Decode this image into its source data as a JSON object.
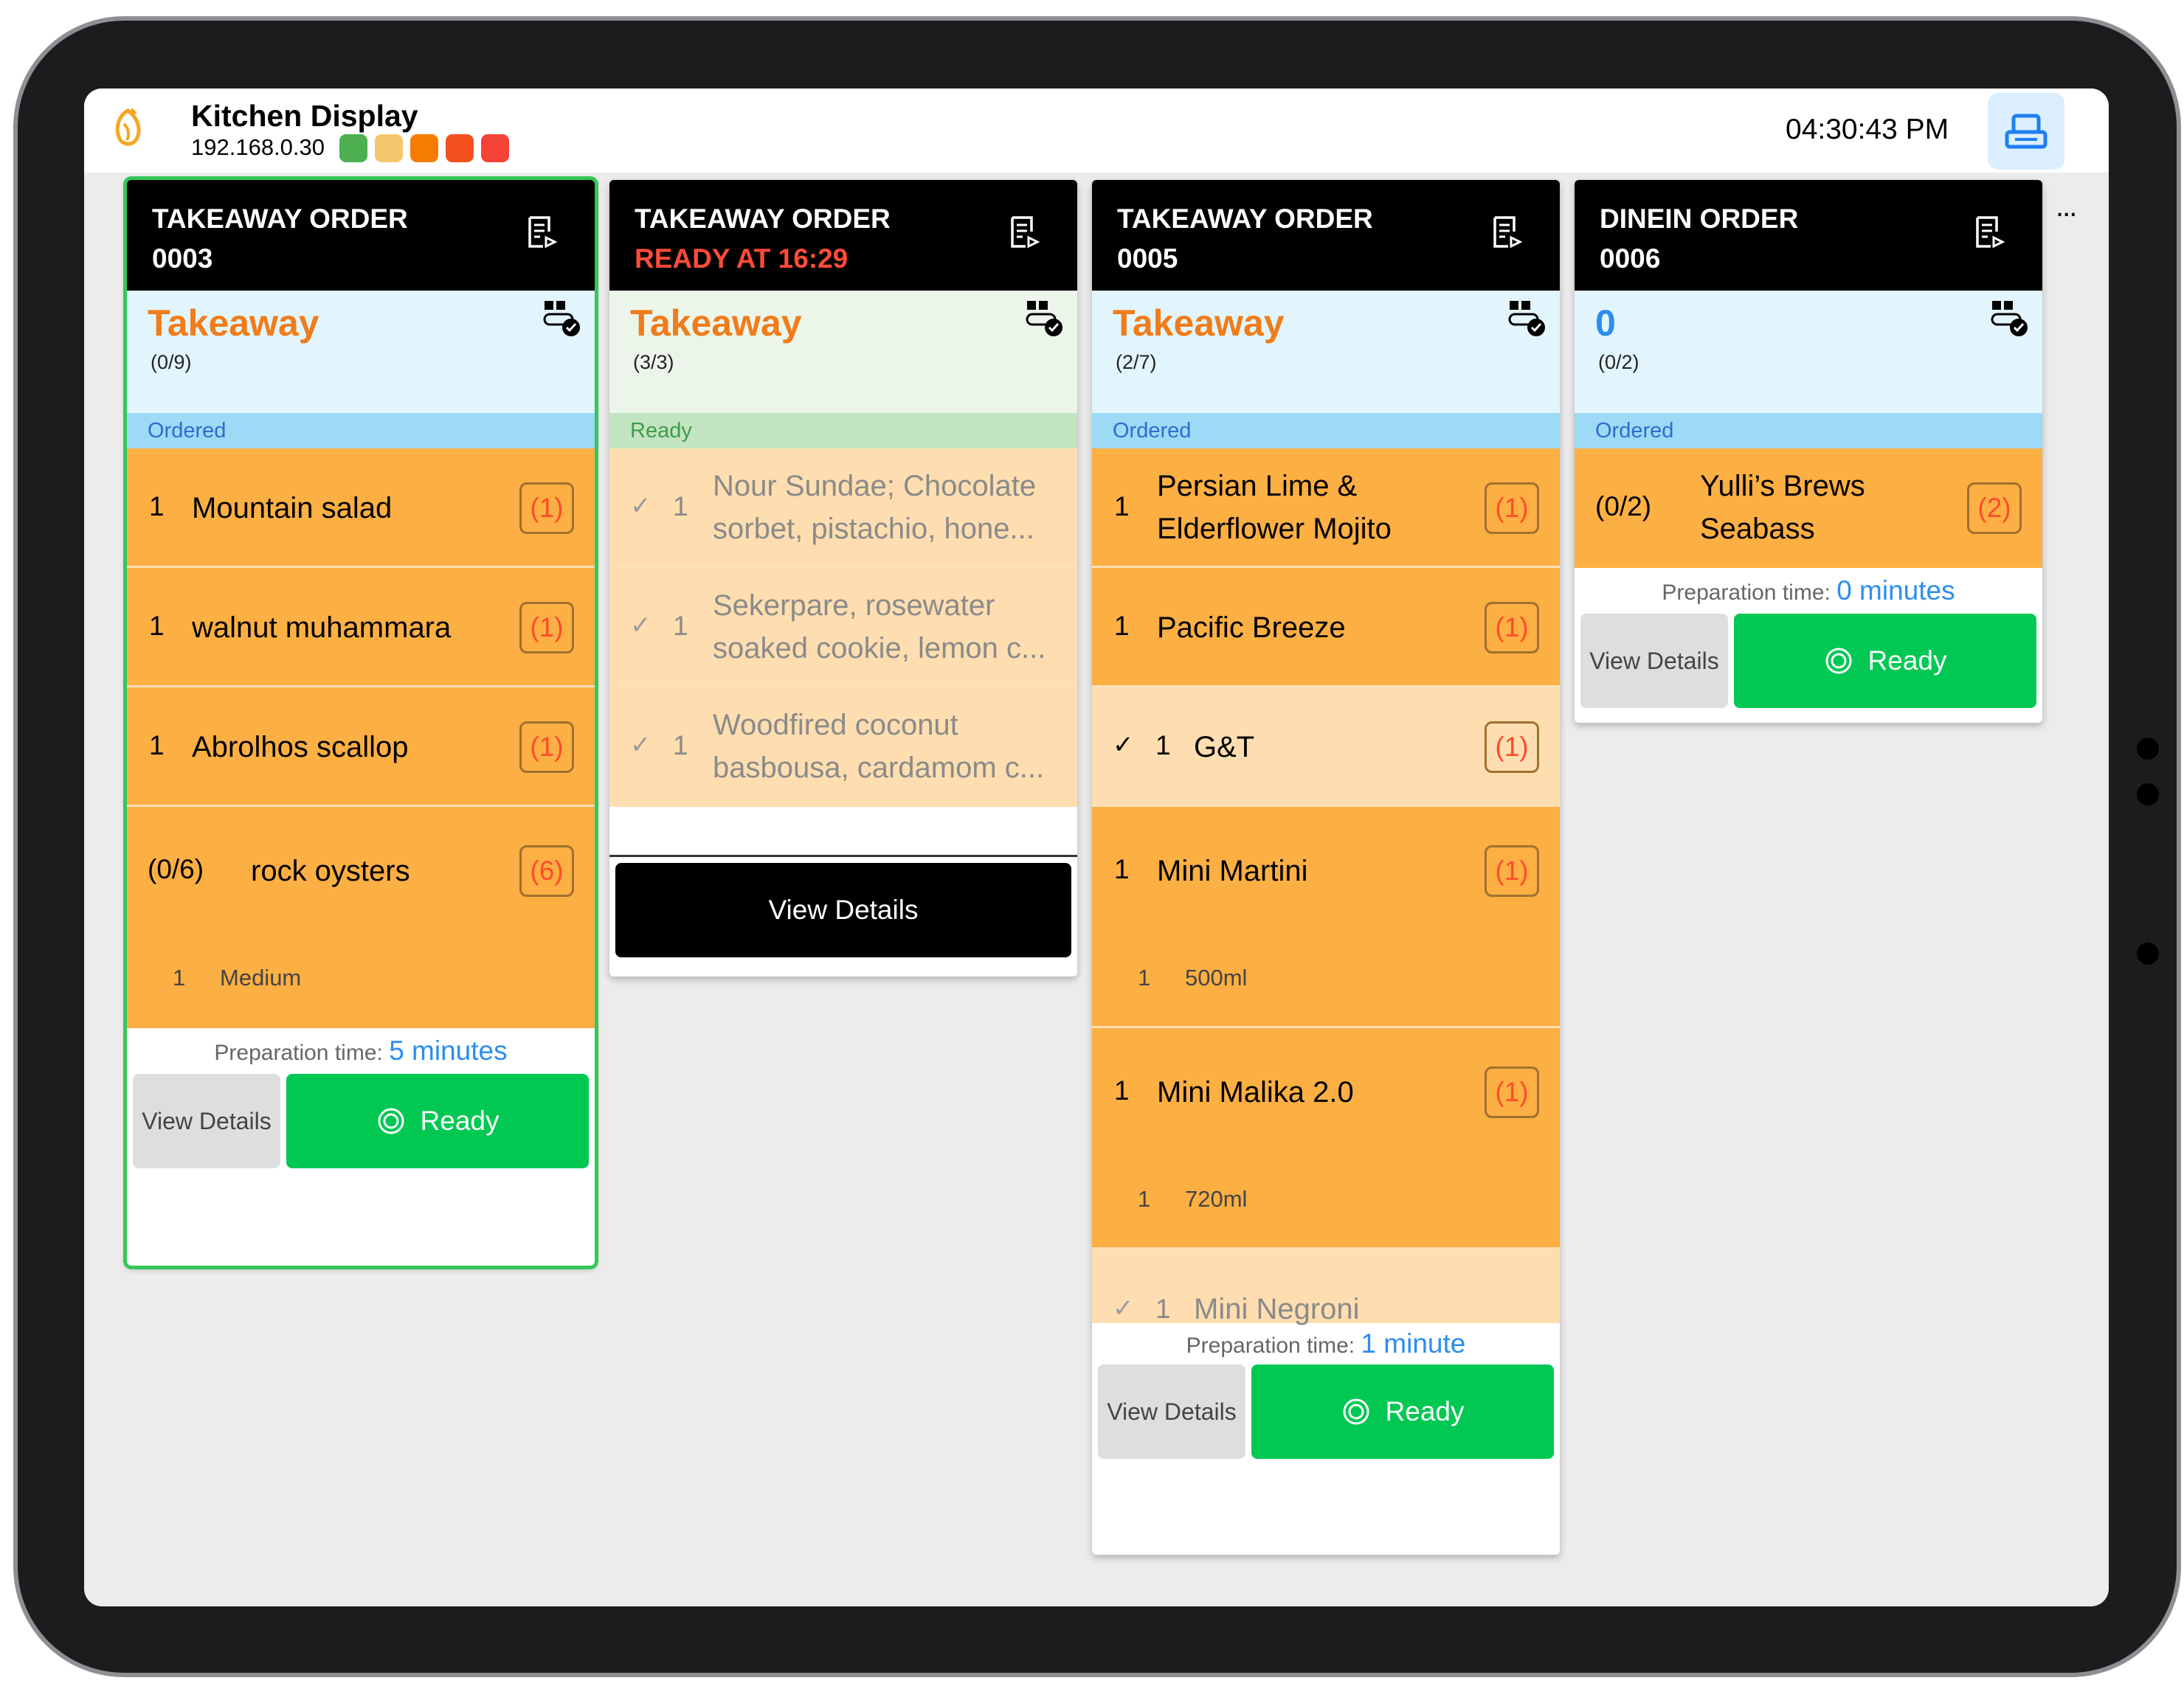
{
  "header": {
    "title": "Kitchen Display",
    "ip": "192.168.0.30",
    "status_colors": [
      "#4caf50",
      "#f6c66c",
      "#f57c00",
      "#f4511e",
      "#f44336"
    ],
    "time": "04:30:43 PM",
    "more_label": "..."
  },
  "orders": [
    {
      "type": "TAKEAWAY ORDER",
      "number": "0003",
      "mode": "Takeaway",
      "count": "(0/9)",
      "status": "Ordered",
      "items": [
        {
          "qty": "1",
          "name": "Mountain salad",
          "badge": "(1)"
        },
        {
          "qty": "1",
          "name": "walnut muhammara",
          "badge": "(1)"
        },
        {
          "qty": "1",
          "name": "Abrolhos scallop",
          "badge": "(1)"
        },
        {
          "qty": "(0/6)",
          "name": "rock oysters",
          "badge": "(6)",
          "modifier_qty": "1",
          "modifier": "Medium"
        }
      ],
      "prep_label": "Preparation time:",
      "prep_time": "5 minutes",
      "view_details": "View Details",
      "ready": "Ready"
    },
    {
      "type": "TAKEAWAY ORDER",
      "number": "READY AT 16:29",
      "mode": "Takeaway",
      "count": "(3/3)",
      "status": "Ready",
      "items": [
        {
          "check": "✓",
          "qty": "1",
          "name1": "Nour Sundae; Chocolate",
          "name2": "sorbet, pistachio, hone..."
        },
        {
          "check": "✓",
          "qty": "1",
          "name1": "Sekerpare, rosewater",
          "name2": "soaked cookie, lemon c..."
        },
        {
          "check": "✓",
          "qty": "1",
          "name1": "Woodfired coconut",
          "name2": "basbousa, cardamom c..."
        }
      ],
      "view_details": "View Details"
    },
    {
      "type": "TAKEAWAY ORDER",
      "number": "0005",
      "mode": "Takeaway",
      "count": "(2/7)",
      "status": "Ordered",
      "items": [
        {
          "qty": "1",
          "name1": "Persian Lime &",
          "name2": "Elderflower Mojito",
          "badge": "(1)"
        },
        {
          "qty": "1",
          "name": "Pacific Breeze",
          "badge": "(1)"
        },
        {
          "check": "✓",
          "qty": "1",
          "name": "G&T",
          "badge": "(1)"
        },
        {
          "qty": "1",
          "name": "Mini Martini",
          "badge": "(1)",
          "modifier_qty": "1",
          "modifier": "500ml"
        },
        {
          "qty": "1",
          "name": "Mini Malika 2.0",
          "badge": "(1)",
          "modifier_qty": "1",
          "modifier": "720ml"
        },
        {
          "check": "✓",
          "qty": "1",
          "name": "Mini Negroni"
        }
      ],
      "prep_label": "Preparation time:",
      "prep_time": "1 minute",
      "view_details": "View Details",
      "ready": "Ready"
    },
    {
      "type": "DINEIN ORDER",
      "number": "0006",
      "mode": "0",
      "count": "(0/2)",
      "status": "Ordered",
      "items": [
        {
          "qty": "(0/2)",
          "name1": "Yulli’s Brews",
          "name2": "Seabass",
          "badge": "(2)"
        }
      ],
      "prep_label": "Preparation time:",
      "prep_time": "0 minutes",
      "view_details": "View Details",
      "ready": "Ready"
    }
  ]
}
